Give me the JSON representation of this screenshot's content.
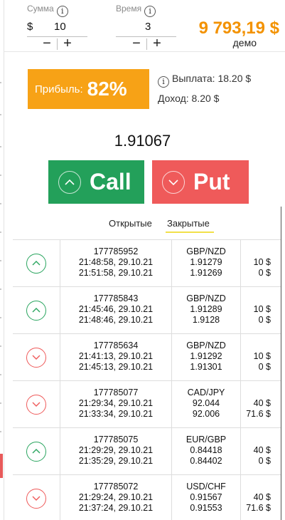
{
  "controls": {
    "amount_label": "Сумма",
    "time_label": "Время",
    "currency_symbol": "$",
    "amount_value": "10",
    "time_value": "3",
    "minus": "−",
    "plus": "+",
    "info_glyph": "i"
  },
  "account": {
    "balance": "9 793,19 $",
    "mode": "демо"
  },
  "profit": {
    "label": "Прибыль:",
    "percent": "82%",
    "payout": "Выплата: 18.20 $",
    "income": "Доход: 8.20 $"
  },
  "price": "1.91067",
  "buttons": {
    "call": "Call",
    "put": "Put"
  },
  "tabs": {
    "open": "Открытые",
    "closed": "Закрытые",
    "active": "closed"
  },
  "colors": {
    "accent_orange": "#f39200",
    "call_green": "#23a05a",
    "put_red": "#ef5a5a",
    "tab_underline": "#f2e04a"
  },
  "trades": [
    {
      "direction": "up",
      "id": "177785952",
      "open_time": "21:48:58, 29.10.21",
      "close_time": "21:51:58, 29.10.21",
      "pair": "GBP/NZD",
      "open_price": "1.91279",
      "close_price": "1.91269",
      "amount": "10 $",
      "payout": "0 $"
    },
    {
      "direction": "up",
      "id": "177785843",
      "open_time": "21:45:46, 29.10.21",
      "close_time": "21:48:46, 29.10.21",
      "pair": "GBP/NZD",
      "open_price": "1.91289",
      "close_price": "1.9128",
      "amount": "10 $",
      "payout": "0 $"
    },
    {
      "direction": "down",
      "id": "177785634",
      "open_time": "21:41:13, 29.10.21",
      "close_time": "21:45:13, 29.10.21",
      "pair": "GBP/NZD",
      "open_price": "1.91292",
      "close_price": "1.91301",
      "amount": "10 $",
      "payout": "0 $"
    },
    {
      "direction": "down",
      "id": "177785077",
      "open_time": "21:29:34, 29.10.21",
      "close_time": "21:33:34, 29.10.21",
      "pair": "CAD/JPY",
      "open_price": "92.044",
      "close_price": "92.006",
      "amount": "40 $",
      "payout": "71.6 $"
    },
    {
      "direction": "up",
      "id": "177785075",
      "open_time": "21:29:29, 29.10.21",
      "close_time": "21:35:29, 29.10.21",
      "pair": "EUR/GBP",
      "open_price": "0.84418",
      "close_price": "0.84402",
      "amount": "40 $",
      "payout": "0 $"
    },
    {
      "direction": "down",
      "id": "177785072",
      "open_time": "21:29:24, 29.10.21",
      "close_time": "21:37:24, 29.10.21",
      "pair": "USD/CHF",
      "open_price": "0.91567",
      "close_price": "0.91553",
      "amount": "40 $",
      "payout": "71.6 $"
    }
  ]
}
